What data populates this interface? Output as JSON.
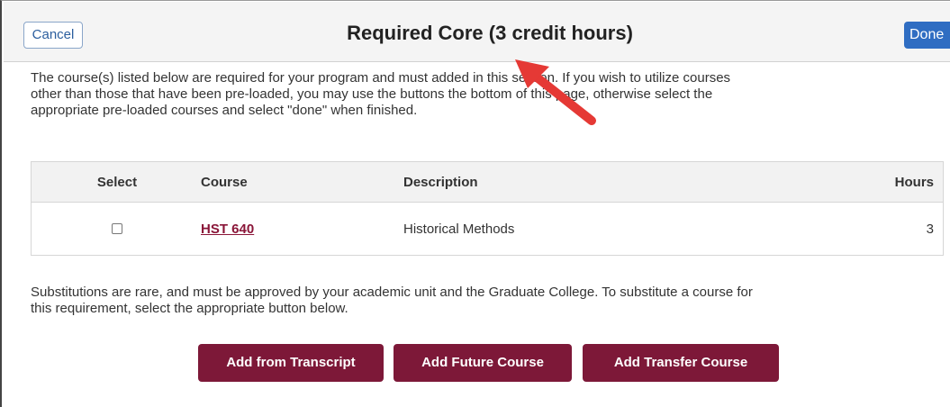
{
  "header": {
    "cancel_label": "Cancel",
    "title": "Required Core (3 credit hours)",
    "done_label": "Done"
  },
  "instructions": {
    "line1": "The course(s) listed below are required for your program and must    added in this section. If you wish to utilize courses",
    "line2": "other than those that have been pre-loaded, you may use the buttons    the bottom of this page, otherwise select the",
    "line3": "appropriate pre-loaded courses and select \"done\" when finished."
  },
  "grid": {
    "headers": {
      "select": "Select",
      "course": "Course",
      "description": "Description",
      "hours": "Hours"
    },
    "rows": [
      {
        "selected": false,
        "course": "HST 640",
        "description": "Historical Methods",
        "hours": "3"
      }
    ]
  },
  "substitution": {
    "line1": "Substitutions are rare, and must be approved by your academic unit and the Graduate College. To substitute a course for",
    "line2": "this requirement, select the appropriate button below."
  },
  "actions": {
    "add_from_transcript": "Add from Transcript",
    "add_future_course": "Add Future Course",
    "add_transfer_course": "Add Transfer Course"
  },
  "colors": {
    "maroon": "#7d1838",
    "link": "#8a1538",
    "done_blue": "#2f6dc2",
    "arrow_red": "#e53935"
  }
}
